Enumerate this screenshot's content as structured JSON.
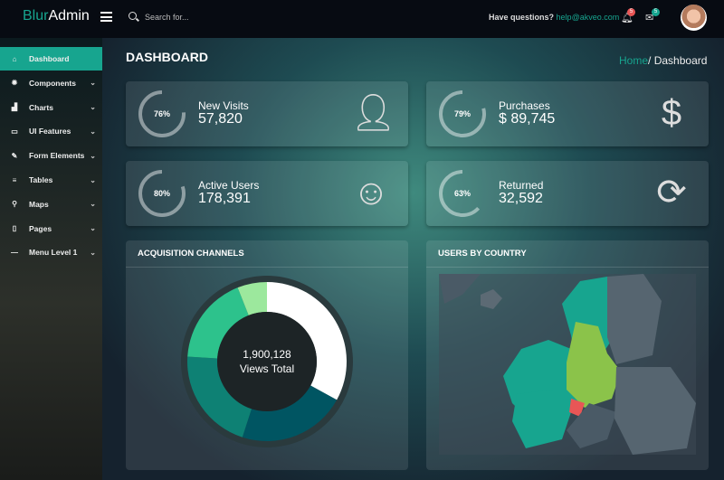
{
  "header": {
    "logo_a": "Blur",
    "logo_b": "Admin",
    "search_placeholder": "Search for...",
    "help_text": "Have questions?",
    "help_email": "help@akveo.com",
    "notifications_count": "5",
    "messages_count": "5"
  },
  "sidebar": {
    "items": [
      {
        "label": "Dashboard",
        "icon": "home-icon",
        "glyph": "⌂",
        "active": true
      },
      {
        "label": "Components",
        "icon": "gear-icon",
        "glyph": "✹"
      },
      {
        "label": "Charts",
        "icon": "bar-chart-icon",
        "glyph": "▟"
      },
      {
        "label": "UI Features",
        "icon": "monitor-icon",
        "glyph": "▭"
      },
      {
        "label": "Form Elements",
        "icon": "edit-icon",
        "glyph": "✎"
      },
      {
        "label": "Tables",
        "icon": "list-icon",
        "glyph": "≡"
      },
      {
        "label": "Maps",
        "icon": "map-pin-icon",
        "glyph": "⚲"
      },
      {
        "label": "Pages",
        "icon": "file-icon",
        "glyph": "▯"
      },
      {
        "label": "Menu Level 1",
        "icon": "dash-icon",
        "glyph": "—"
      }
    ]
  },
  "page": {
    "title": "DASHBOARD",
    "breadcrumb_home": "Home",
    "breadcrumb_sep": "/",
    "breadcrumb_current": "Dashboard"
  },
  "cards": [
    {
      "label": "New Visits",
      "value": "57,820",
      "percent": 76,
      "percent_text": "76%",
      "icon": "user-icon"
    },
    {
      "label": "Purchases",
      "value": "$ 89,745",
      "percent": 79,
      "percent_text": "79%",
      "icon": "dollar-icon"
    },
    {
      "label": "Active Users",
      "value": "178,391",
      "percent": 80,
      "percent_text": "80%",
      "icon": "smiley-icon"
    },
    {
      "label": "Returned",
      "value": "32,592",
      "percent": 63,
      "percent_text": "63%",
      "icon": "refresh-icon"
    }
  ],
  "acquisition": {
    "title": "ACQUISITION CHANNELS",
    "total": "1,900,128",
    "total_label": "Views Total",
    "segments": [
      {
        "share": 33,
        "color": "#ffffff"
      },
      {
        "share": 22,
        "color": "#005562"
      },
      {
        "share": 21,
        "color": "#0e8174"
      },
      {
        "share": 18,
        "color": "#2dc28c"
      },
      {
        "share": 6,
        "color": "#9ce89d"
      }
    ]
  },
  "countries": {
    "title": "USERS BY COUNTRY"
  }
}
